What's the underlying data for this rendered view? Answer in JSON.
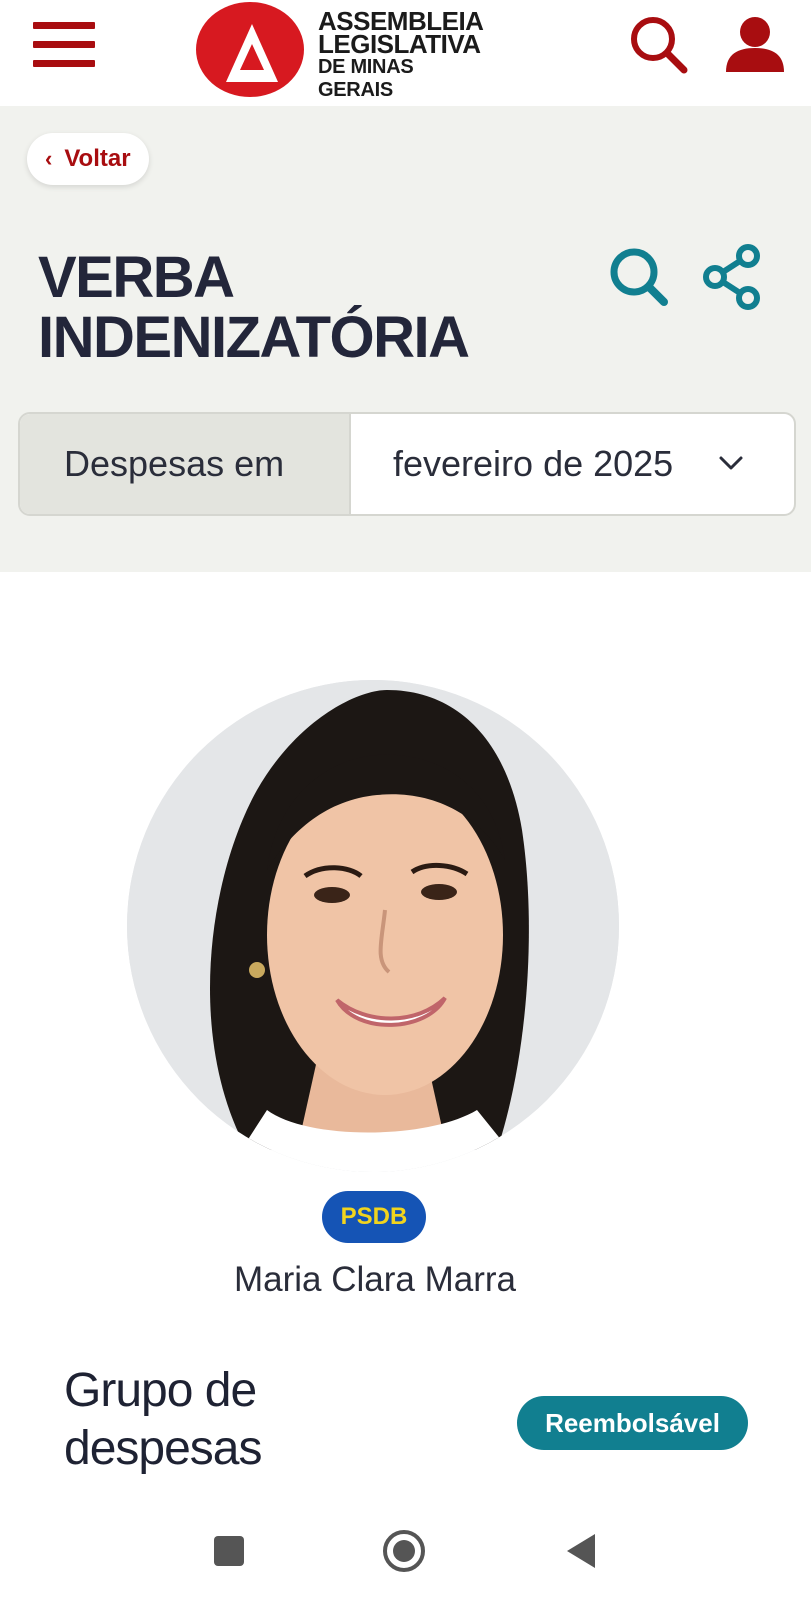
{
  "header": {
    "logo_line1": "ASSEMBLEIA",
    "logo_line2": "LEGISLATIVA",
    "logo_line3": "DE MINAS GERAIS",
    "menu_icon": "hamburger-menu-icon",
    "search_icon": "search-icon",
    "user_icon": "user-icon",
    "brand_color": "#a80d10"
  },
  "hero": {
    "back_label": "Voltar",
    "title": "VERBA INDENIZATÓRIA",
    "search_icon": "search-icon",
    "share_icon": "share-icon",
    "accent_color": "#117f90"
  },
  "period": {
    "label": "Despesas em",
    "selected": "fevereiro de 2025"
  },
  "member": {
    "party": "PSDB",
    "name": "Maria Clara Marra"
  },
  "expenses": {
    "group_title": "Grupo de despesas",
    "type_badge": "Reembolsável"
  },
  "system_nav": {
    "recents_icon": "recents-square-icon",
    "home_icon": "home-circle-icon",
    "back_icon": "back-triangle-icon"
  }
}
